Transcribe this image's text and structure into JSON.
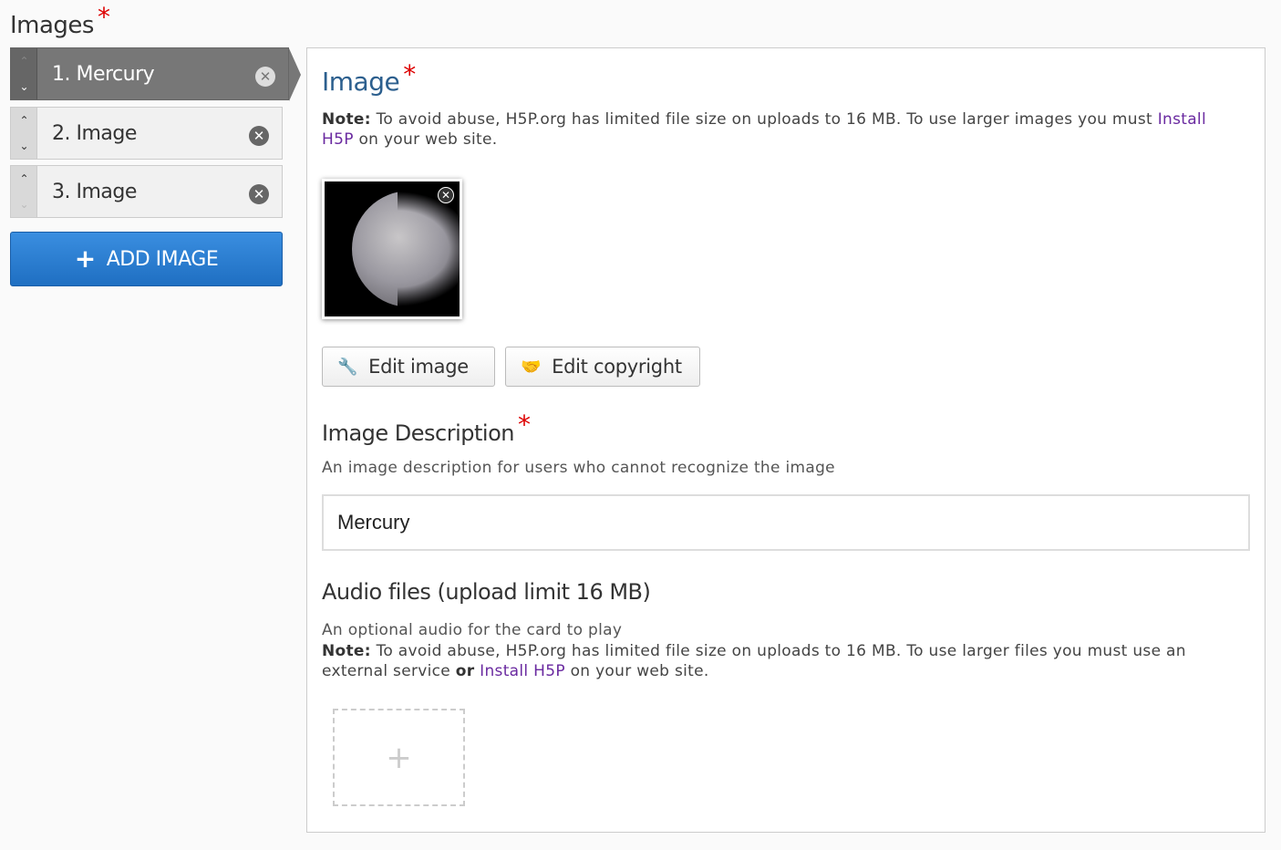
{
  "field": {
    "title": "Images",
    "required_mark": "*"
  },
  "list": {
    "items": [
      {
        "label": "1. Mercury",
        "up": "⌃",
        "down": "⌄",
        "remove": "✕"
      },
      {
        "label": "2. Image",
        "up": "⌃",
        "down": "⌄",
        "remove": "✕"
      },
      {
        "label": "3. Image",
        "up": "⌃",
        "down": "⌄",
        "remove": "✕"
      }
    ],
    "add_button": {
      "plus": "+",
      "label": "ADD IMAGE"
    }
  },
  "panel": {
    "image_title": "Image",
    "required_mark": "*",
    "image_note": {
      "bold": "Note:",
      "text": " To avoid abuse, H5P.org has limited file size on uploads to 16 MB. To use larger images you must ",
      "link": "Install H5P",
      "tail": " on your web site."
    },
    "edit_image": {
      "icon": "wrench-icon",
      "label": "Edit image"
    },
    "edit_copyright": {
      "icon": "handshake-icon",
      "label": "Edit copyright"
    },
    "description_title": "Image Description",
    "description_help": "An image description for users who cannot recognize the image",
    "description_value": "Mercury",
    "audio_title": "Audio files (upload limit 16 MB)",
    "audio_help": "An optional audio for the card to play",
    "audio_note": {
      "bold": "Note:",
      "text": " To avoid abuse, H5P.org has limited file size on uploads to 16 MB. To use larger files you must use an external service ",
      "or": "or",
      "link": "Install H5P",
      "tail": " on your web site."
    },
    "audio_add": "+"
  },
  "colors": {
    "active_item": "#777777",
    "add_button": "#2a7fd4",
    "title_blue": "#2c5f8e",
    "link": "#6a2aa0",
    "required": "#dd0000"
  }
}
